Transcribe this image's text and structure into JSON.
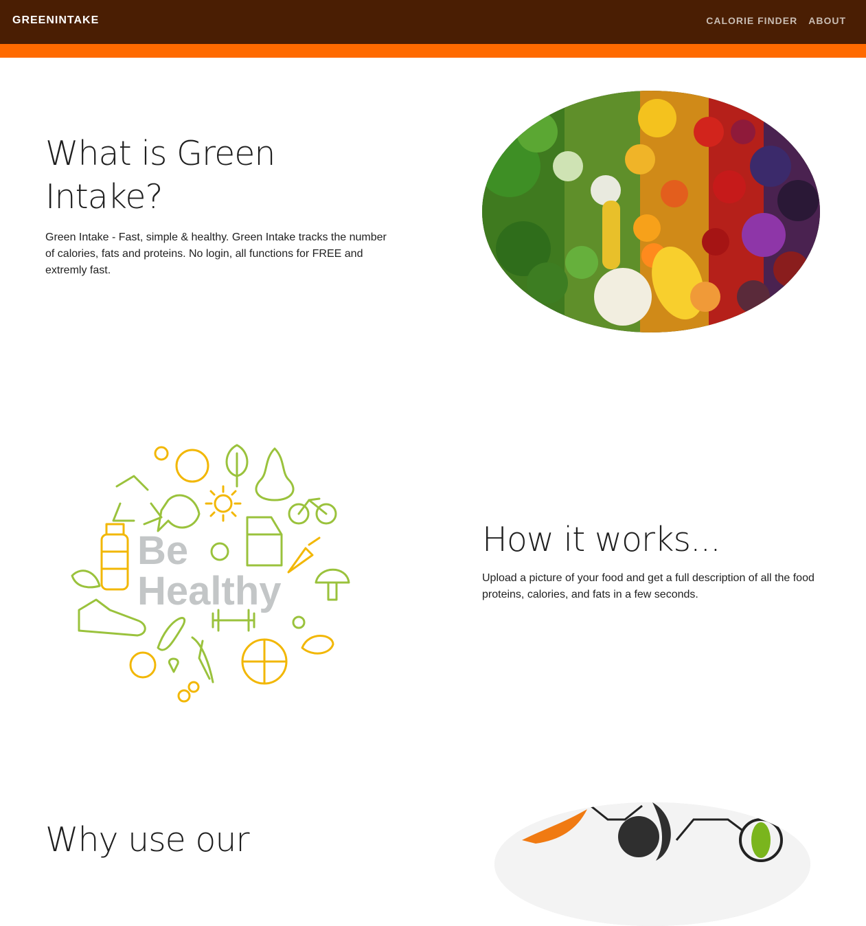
{
  "nav": {
    "brand": "GREENINTAKE",
    "links": [
      "CALORIE FINDER",
      "ABOUT"
    ]
  },
  "section1": {
    "title": "What is Green Intake?",
    "text": "Green Intake - Fast, simple & healthy. Green Intake tracks the number of calories, fats and proteins. No login, all functions for FREE and extremly fast."
  },
  "section2": {
    "art_line1": "Be",
    "art_line2": "Healthy",
    "title": "How it works...",
    "text": "Upload a picture of your food and get a full description of all the food proteins, calories, and fats in a few seconds."
  },
  "section3": {
    "title": "Why use our"
  },
  "colors": {
    "nav_bg": "#4a1e03",
    "accent": "#ff6a00",
    "icon_green": "#9ac23c",
    "icon_yellow": "#f2b705"
  }
}
